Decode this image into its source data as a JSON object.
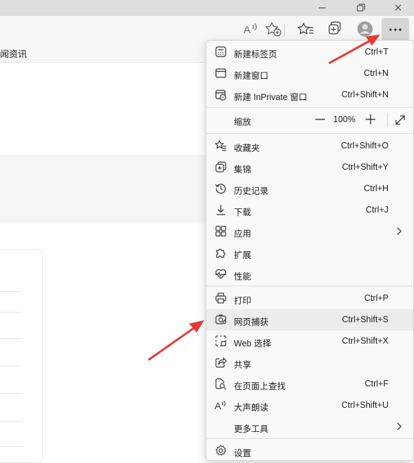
{
  "window_controls": {
    "minimize_icon": "minimize-icon",
    "maximize_icon": "restore-icon",
    "close_icon": "close-icon"
  },
  "toolbar": {
    "icons": [
      "read-aloud-icon",
      "add-favorite-icon",
      "favorites-icon",
      "collections-icon",
      "profile-icon",
      "more-icon"
    ]
  },
  "favorites_bar": {
    "partial_item": "闻资讯"
  },
  "menu": {
    "items": [
      {
        "id": "new-tab",
        "icon": "new-tab-icon",
        "label": "新建标签页",
        "shortcut": "Ctrl+T"
      },
      {
        "id": "new-window",
        "icon": "new-window-icon",
        "label": "新建窗口",
        "shortcut": "Ctrl+N"
      },
      {
        "id": "new-inprivate",
        "icon": "inprivate-window-icon",
        "label": "新建 InPrivate 窗口",
        "shortcut": "Ctrl+Shift+N"
      },
      {
        "id": "favorites",
        "icon": "favorites-icon",
        "label": "收藏夹",
        "shortcut": "Ctrl+Shift+O"
      },
      {
        "id": "collections",
        "icon": "collections-icon",
        "label": "集锦",
        "shortcut": "Ctrl+Shift+Y"
      },
      {
        "id": "history",
        "icon": "history-icon",
        "label": "历史记录",
        "shortcut": "Ctrl+H"
      },
      {
        "id": "downloads",
        "icon": "download-icon",
        "label": "下载",
        "shortcut": "Ctrl+J"
      },
      {
        "id": "apps",
        "icon": "apps-icon",
        "label": "应用",
        "shortcut": ""
      },
      {
        "id": "extensions",
        "icon": "extensions-icon",
        "label": "扩展",
        "shortcut": ""
      },
      {
        "id": "performance",
        "icon": "performance-icon",
        "label": "性能",
        "shortcut": ""
      },
      {
        "id": "print",
        "icon": "print-icon",
        "label": "打印",
        "shortcut": "Ctrl+P"
      },
      {
        "id": "web-capture",
        "icon": "web-capture-icon",
        "label": "网页捕获",
        "shortcut": "Ctrl+Shift+S"
      },
      {
        "id": "web-select",
        "icon": "web-select-icon",
        "label": "Web 选择",
        "shortcut": "Ctrl+Shift+X"
      },
      {
        "id": "share",
        "icon": "share-icon",
        "label": "共享",
        "shortcut": ""
      },
      {
        "id": "find",
        "icon": "find-on-page-icon",
        "label": "在页面上查找",
        "shortcut": "Ctrl+F"
      },
      {
        "id": "read-aloud",
        "icon": "read-aloud-icon",
        "label": "大声朗读",
        "shortcut": "Ctrl+Shift+U"
      },
      {
        "id": "more-tools",
        "icon": "more-tools-icon",
        "label": "更多工具",
        "shortcut": ""
      },
      {
        "id": "settings",
        "icon": "settings-icon",
        "label": "设置",
        "shortcut": ""
      }
    ],
    "zoom": {
      "label": "缩放",
      "value": "100%",
      "minus_icon": "zoom-out-icon",
      "plus_icon": "zoom-in-icon",
      "fullscreen_icon": "fullscreen-icon"
    },
    "highlighted_item": "web-capture"
  },
  "annotations": {
    "arrow_color": "#e53935"
  }
}
